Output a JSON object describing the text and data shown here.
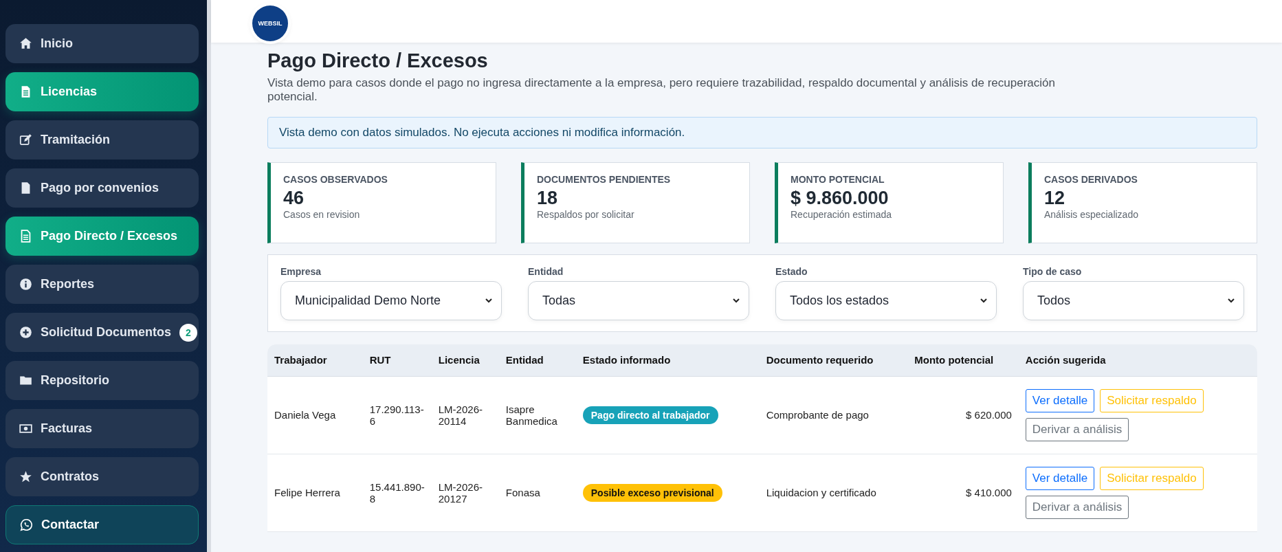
{
  "sidebar": {
    "items": [
      {
        "label": "Inicio",
        "selected": false,
        "kind": "nav"
      },
      {
        "label": "Licencias",
        "selected": true,
        "kind": "nav"
      },
      {
        "label": "Tramitación",
        "selected": false,
        "kind": "nav"
      },
      {
        "label": "Pago por convenios",
        "selected": false,
        "kind": "nav"
      },
      {
        "label": "Pago Directo / Excesos",
        "selected": true,
        "kind": "nav"
      },
      {
        "label": "Reportes",
        "selected": false,
        "kind": "nav"
      },
      {
        "label": "Solicitud Documentos",
        "selected": false,
        "kind": "nav",
        "badge": "2"
      },
      {
        "label": "Repositorio",
        "selected": false,
        "kind": "nav"
      },
      {
        "label": "Facturas",
        "selected": false,
        "kind": "nav"
      },
      {
        "label": "Contratos",
        "selected": false,
        "kind": "nav"
      },
      {
        "label": "Contactar",
        "selected": false,
        "kind": "contact"
      }
    ]
  },
  "header": {
    "logo_text": "WEBSIL"
  },
  "page": {
    "title": "Pago Directo / Excesos",
    "description": "Vista demo para casos donde el pago no ingresa directamente a la empresa, pero requiere trazabilidad, respaldo documental y análisis de recuperación potencial."
  },
  "alert": "Vista demo con datos simulados. No ejecuta acciones ni modifica información.",
  "stats": [
    {
      "label": "CASOS OBSERVADOS",
      "value": "46",
      "note": "Casos en revision"
    },
    {
      "label": "DOCUMENTOS PENDIENTES",
      "value": "18",
      "note": "Respaldos por solicitar"
    },
    {
      "label": "MONTO POTENCIAL",
      "value": "$ 9.860.000",
      "note": "Recuperación estimada"
    },
    {
      "label": "CASOS DERIVADOS",
      "value": "12",
      "note": "Análisis especializado"
    }
  ],
  "filters": [
    {
      "label": "Empresa",
      "value": "Municipalidad Demo Norte"
    },
    {
      "label": "Entidad",
      "value": "Todas"
    },
    {
      "label": "Estado",
      "value": "Todos los estados"
    },
    {
      "label": "Tipo de caso",
      "value": "Todos"
    }
  ],
  "table": {
    "columns": [
      "Trabajador",
      "RUT",
      "Licencia",
      "Entidad",
      "Estado informado",
      "Documento requerido",
      "Monto potencial",
      "Acción sugerida"
    ],
    "rows": [
      {
        "trabajador": "Daniela Vega",
        "rut": "17.290.113-6",
        "licencia": "LM-2026-20114",
        "entidad": "Isapre Banmedica",
        "estado": {
          "text": "Pago directo al trabajador",
          "kind": "info"
        },
        "documento": "Comprobante de pago",
        "monto": "$ 620.000",
        "actions": [
          {
            "label": "Ver detalle",
            "kind": "primary"
          },
          {
            "label": "Solicitar respaldo",
            "kind": "warning"
          },
          {
            "label": "Derivar a análisis",
            "kind": "secondary"
          }
        ]
      },
      {
        "trabajador": "Felipe Herrera",
        "rut": "15.441.890-8",
        "licencia": "LM-2026-20127",
        "entidad": "Fonasa",
        "estado": {
          "text": "Posible exceso previsional",
          "kind": "warning"
        },
        "documento": "Liquidacion y certificado",
        "monto": "$ 410.000",
        "actions": [
          {
            "label": "Ver detalle",
            "kind": "primary"
          },
          {
            "label": "Solicitar respaldo",
            "kind": "warning"
          },
          {
            "label": "Derivar a análisis",
            "kind": "secondary"
          }
        ]
      }
    ]
  }
}
